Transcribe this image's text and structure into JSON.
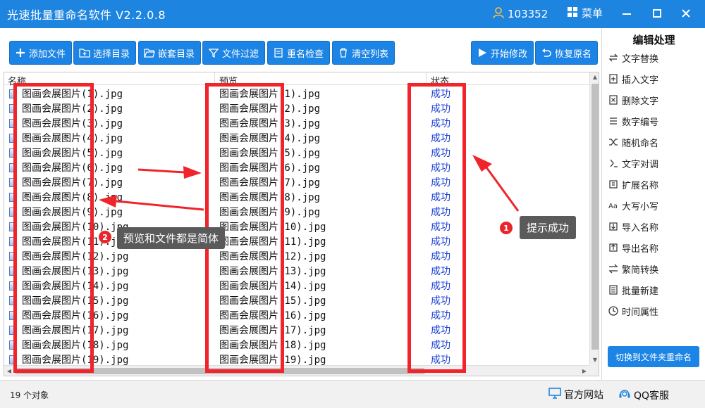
{
  "window": {
    "title": "光速批量重命名软件 V2.2.0.8",
    "user_id": "103352",
    "menu_label": "菜单"
  },
  "toolbar": {
    "add_file": "添加文件",
    "select_dir": "选择目录",
    "nested_dir": "嵌套目录",
    "file_filter": "文件过滤",
    "rename_check": "重名检查",
    "clear_list": "清空列表",
    "start_modify": "开始修改",
    "restore_name": "恢复原名"
  },
  "list": {
    "columns": [
      "名称",
      "预览",
      "状态"
    ],
    "rows": [
      {
        "name": "图画会展图片(1).jpg",
        "preview": "图画会展图片(1).jpg",
        "status": "成功"
      },
      {
        "name": "图画会展图片(2).jpg",
        "preview": "图画会展图片(2).jpg",
        "status": "成功"
      },
      {
        "name": "图画会展图片(3).jpg",
        "preview": "图画会展图片(3).jpg",
        "status": "成功"
      },
      {
        "name": "图画会展图片(4).jpg",
        "preview": "图画会展图片(4).jpg",
        "status": "成功"
      },
      {
        "name": "图画会展图片(5).jpg",
        "preview": "图画会展图片(5).jpg",
        "status": "成功"
      },
      {
        "name": "图画会展图片(6).jpg",
        "preview": "图画会展图片(6).jpg",
        "status": "成功"
      },
      {
        "name": "图画会展图片(7).jpg",
        "preview": "图画会展图片(7).jpg",
        "status": "成功"
      },
      {
        "name": "图画会展图片(8).jpg",
        "preview": "图画会展图片(8).jpg",
        "status": "成功"
      },
      {
        "name": "图画会展图片(9).jpg",
        "preview": "图画会展图片(9).jpg",
        "status": "成功"
      },
      {
        "name": "图画会展图片(10).jpg",
        "preview": "图画会展图片(10).jpg",
        "status": "成功"
      },
      {
        "name": "图画会展图片(11).jpg",
        "preview": "图画会展图片(11).jpg",
        "status": "成功"
      },
      {
        "name": "图画会展图片(12).jpg",
        "preview": "图画会展图片(12).jpg",
        "status": "成功"
      },
      {
        "name": "图画会展图片(13).jpg",
        "preview": "图画会展图片(13).jpg",
        "status": "成功"
      },
      {
        "name": "图画会展图片(14).jpg",
        "preview": "图画会展图片(14).jpg",
        "status": "成功"
      },
      {
        "name": "图画会展图片(15).jpg",
        "preview": "图画会展图片(15).jpg",
        "status": "成功"
      },
      {
        "name": "图画会展图片(16).jpg",
        "preview": "图画会展图片(16).jpg",
        "status": "成功"
      },
      {
        "name": "图画会展图片(17).jpg",
        "preview": "图画会展图片(17).jpg",
        "status": "成功"
      },
      {
        "name": "图画会展图片(18).jpg",
        "preview": "图画会展图片(18).jpg",
        "status": "成功"
      },
      {
        "name": "图画会展图片(19).jpg",
        "preview": "图画会展图片(19).jpg",
        "status": "成功"
      }
    ]
  },
  "annotations": {
    "callout1_num": "1",
    "callout1_text": "提示成功",
    "callout2_num": "2",
    "callout2_text": "预览和文件都是简体",
    "highlight_color": "#f0242a"
  },
  "sidebar": {
    "title": "编辑处理",
    "items": [
      {
        "label": "文字替换",
        "icon": "replace-icon"
      },
      {
        "label": "插入文字",
        "icon": "insert-icon"
      },
      {
        "label": "删除文字",
        "icon": "delete-icon"
      },
      {
        "label": "数字编号",
        "icon": "number-icon"
      },
      {
        "label": "随机命名",
        "icon": "shuffle-icon"
      },
      {
        "label": "文字对调",
        "icon": "swap-icon"
      },
      {
        "label": "扩展名称",
        "icon": "extension-icon"
      },
      {
        "label": "大写小写",
        "icon": "case-icon"
      },
      {
        "label": "导入名称",
        "icon": "import-icon"
      },
      {
        "label": "导出名称",
        "icon": "export-icon"
      },
      {
        "label": "繁简转换",
        "icon": "convert-icon"
      },
      {
        "label": "批量新建",
        "icon": "new-batch-icon"
      },
      {
        "label": "时间属性",
        "icon": "clock-icon"
      }
    ],
    "switch_button": "切换到文件夹重命名"
  },
  "status": {
    "count": "19 个对象",
    "website": "官方网站",
    "qq_support": "QQ客服"
  },
  "colors": {
    "brand_blue": "#1d84e0",
    "success_text": "#1a3fd6",
    "annotation_red": "#f0242a"
  }
}
